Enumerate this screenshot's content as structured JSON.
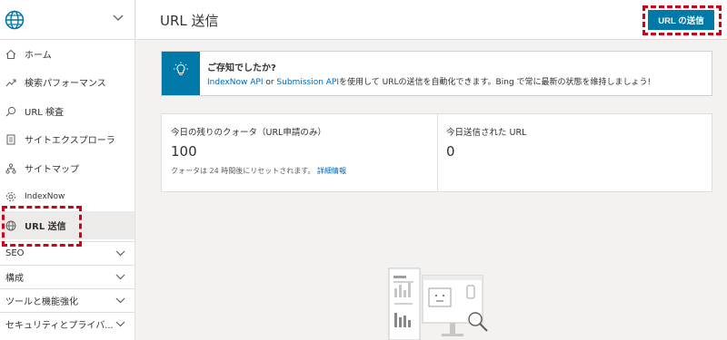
{
  "header": {
    "title": "URL 送信",
    "submit_button": "URL の送信"
  },
  "sidebar": {
    "items": [
      {
        "label": "ホーム",
        "icon": "home-icon"
      },
      {
        "label": "検索パフォーマンス",
        "icon": "trend-icon"
      },
      {
        "label": "URL 検査",
        "icon": "search-icon"
      },
      {
        "label": "サイトエクスプローラ",
        "icon": "document-icon"
      },
      {
        "label": "サイトマップ",
        "icon": "sitemap-icon"
      },
      {
        "label": "IndexNow",
        "icon": "gear-icon"
      },
      {
        "label": "URL 送信",
        "icon": "globe-icon"
      }
    ],
    "sections": [
      {
        "label": "SEO"
      },
      {
        "label": "構成"
      },
      {
        "label": "ツールと機能強化"
      },
      {
        "label": "セキュリティとプライバ..."
      }
    ]
  },
  "banner": {
    "title": "ご存知でしたか?",
    "link1": "IndexNow API",
    "text_or": " or ",
    "link2": "Submission API",
    "text_rest": "を使用して URLの送信を自動化できます。Bing で常に最新の状態を維持しましょう!"
  },
  "quota": {
    "label": "今日の残りのクォータ（URL申請のみ）",
    "value": "100",
    "note": "クォータは 24 時間後にリセットされます。",
    "note_link": "詳細情報"
  },
  "submitted": {
    "label": "今日送信された URL",
    "value": "0"
  },
  "colors": {
    "accent": "#0078a8",
    "highlight": "#d0021b",
    "link": "#0067b8"
  }
}
